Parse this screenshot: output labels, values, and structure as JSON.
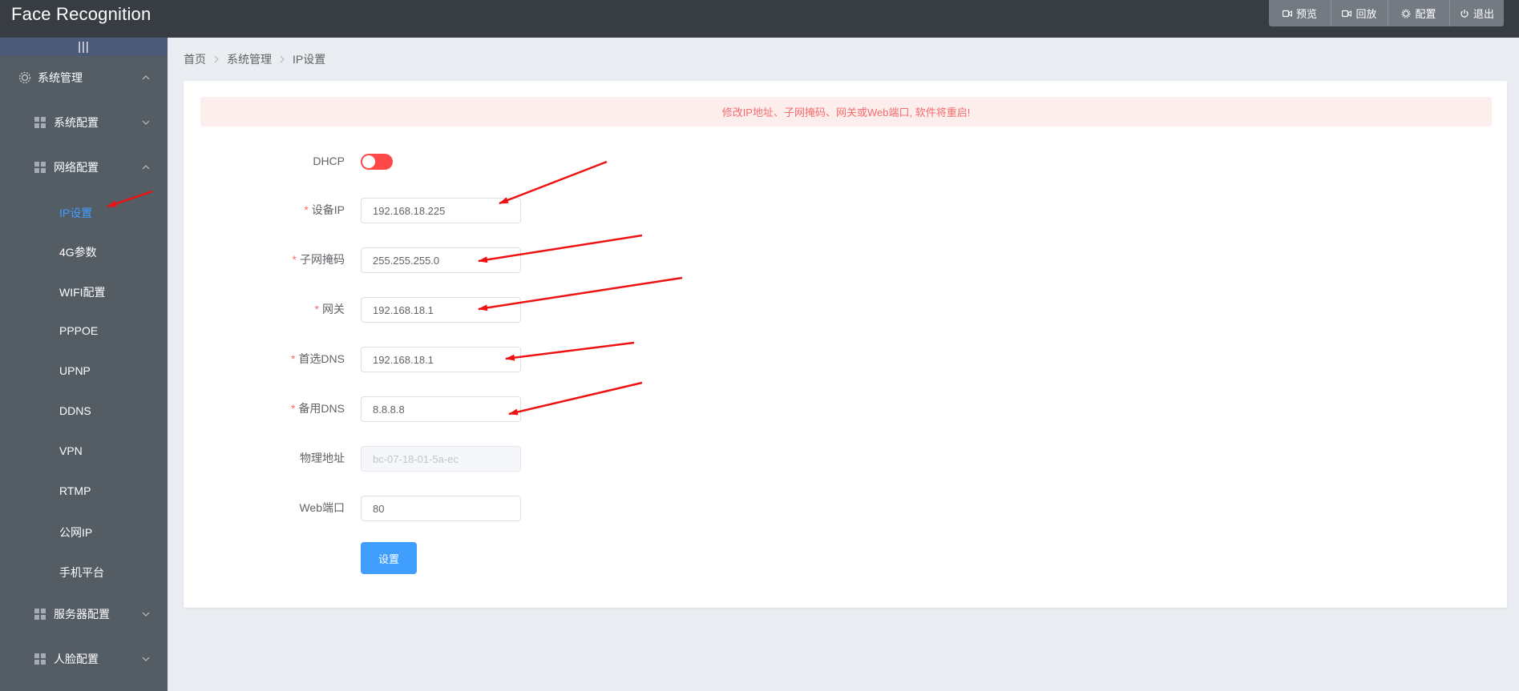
{
  "header": {
    "title": "Face Recognition",
    "actions": [
      {
        "label": "预览",
        "icon": "video-camera-icon"
      },
      {
        "label": "回放",
        "icon": "video-camera-icon"
      },
      {
        "label": "配置",
        "icon": "gear-icon"
      },
      {
        "label": "退出",
        "icon": "power-icon"
      }
    ]
  },
  "sidebar": {
    "collapse_label": "|||",
    "items": [
      {
        "label": "系统管理",
        "icon": "gear-icon",
        "expanded": true
      },
      {
        "label": "系统配置",
        "icon": "grid-icon",
        "expanded": false
      },
      {
        "label": "网络配置",
        "icon": "grid-icon",
        "expanded": true
      },
      {
        "label": "服务器配置",
        "icon": "grid-icon",
        "expanded": false
      },
      {
        "label": "人脸配置",
        "icon": "grid-icon",
        "expanded": false
      }
    ],
    "network_sub": [
      "IP设置",
      "4G参数",
      "WIFI配置",
      "PPPOE",
      "UPNP",
      "DDNS",
      "VPN",
      "RTMP",
      "公网IP",
      "手机平台"
    ],
    "active_sub": "IP设置"
  },
  "breadcrumb": [
    "首页",
    "系统管理",
    "IP设置"
  ],
  "alert": "修改IP地址、子网掩码、网关或Web端口, 软件将重启!",
  "form": {
    "dhcp_label": "DHCP",
    "dhcp_enabled": false,
    "ip_label": "设备IP",
    "ip_value": "192.168.18.225",
    "mask_label": "子网掩码",
    "mask_value": "255.255.255.0",
    "gateway_label": "网关",
    "gateway_value": "192.168.18.1",
    "dns1_label": "首选DNS",
    "dns1_value": "192.168.18.1",
    "dns2_label": "备用DNS",
    "dns2_value": "8.8.8.8",
    "mac_label": "物理地址",
    "mac_value": "bc-07-18-01-5a-ec",
    "port_label": "Web端口",
    "port_value": "80",
    "required_mark": "*",
    "submit_label": "设置"
  },
  "colors": {
    "header_bg": "#383d43",
    "sidebar_bg": "#545c64",
    "active_link": "#409eff",
    "switch_off": "#ff4949",
    "alert_bg": "#fdeeee",
    "alert_text": "#f56c6c",
    "annotation_arrow": "#ee1111"
  }
}
